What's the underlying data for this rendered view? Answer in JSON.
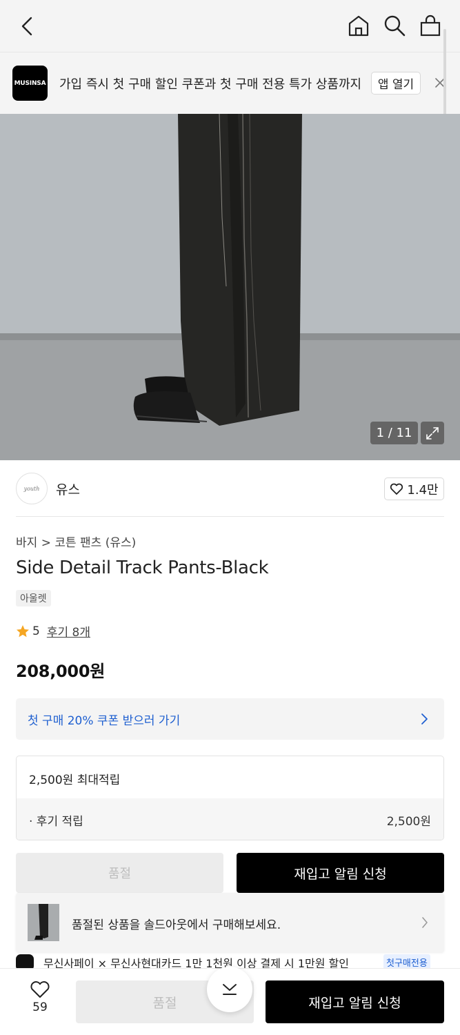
{
  "header": {
    "back_icon": "chevron-left-icon",
    "home_icon": "home-icon",
    "search_icon": "search-icon",
    "cart_icon": "shopping-bag-icon"
  },
  "banner": {
    "logo_text": "MUSINSA",
    "message": "가입 즉시 첫 구매 할인 쿠폰과 첫 구매 전용 특가 상품까지",
    "open_app_label": "앱 열기",
    "close_icon": "close-icon"
  },
  "gallery": {
    "current": "1",
    "total": "11",
    "counter_text": "1 / 11",
    "expand_icon": "expand-icon"
  },
  "brand": {
    "logo_text": "youth",
    "name": "유스",
    "likes": "1.4만"
  },
  "product": {
    "breadcrumb_category": "바지",
    "breadcrumb_sub": "코튼 팬츠 (유스)",
    "title": "Side Detail Track Pants-Black",
    "tag": "아울렛",
    "rating": "5",
    "review_link": "후기 8개",
    "price": "208,000원"
  },
  "coupon": {
    "text": "첫 구매 20% 쿠폰 받으러 가기"
  },
  "points": {
    "header": "2,500원 최대적립",
    "review_label": "· 후기 적립",
    "review_value": "2,500원"
  },
  "actions": {
    "sold_out": "품절",
    "restock": "재입고 알림 신청"
  },
  "soldout_popup": {
    "text": "품절된 상품을 솔드아웃에서 구매해보세요."
  },
  "payment": {
    "text": "무신사페이 × 무신사현대카드 1만 1천원 이상 결제 시 1만원 할인",
    "badge": "첫구매전용"
  },
  "bottom_bar": {
    "like_count": "59",
    "sold_out": "품절",
    "restock": "재입고 알림 신청"
  },
  "colors": {
    "accent_blue": "#1e5fd0",
    "primary_black": "#000000",
    "disabled_gray": "#ececec",
    "star": "#f5a623"
  }
}
